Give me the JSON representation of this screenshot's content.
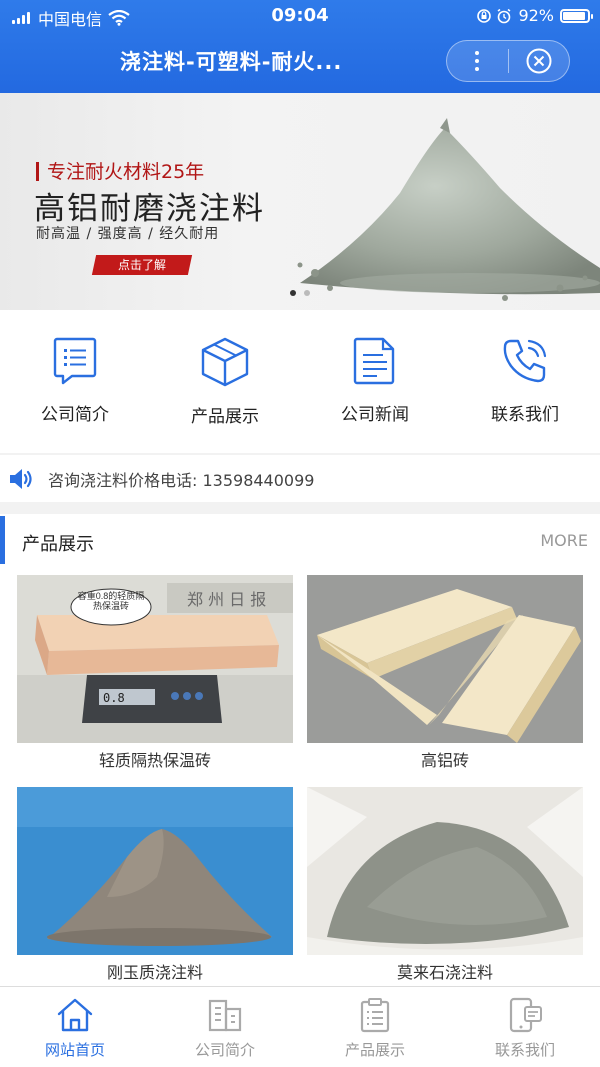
{
  "status_bar": {
    "carrier": "中国电信",
    "time": "09:04",
    "battery": "92%"
  },
  "header": {
    "title": "浇注料-可塑料-耐火..."
  },
  "banner": {
    "tagline": "专注耐火材料25年",
    "headline": "高铝耐磨浇注料",
    "features": "耐高温 / 强度高 / 经久耐用",
    "cta": "点击了解"
  },
  "menu": [
    {
      "label": "公司简介",
      "icon": "chat-doc-icon"
    },
    {
      "label": "产品展示",
      "icon": "cube-icon"
    },
    {
      "label": "公司新闻",
      "icon": "document-icon"
    },
    {
      "label": "联系我们",
      "icon": "phone-icon"
    }
  ],
  "notice": {
    "text": "咨询浇注料价格电话: 13598440099"
  },
  "products": {
    "title": "产品展示",
    "more": "MORE",
    "items": [
      {
        "name": "轻质隔热保温砖",
        "bubble": "容重0.8的轻质隔热保温砖",
        "scale_display": "0.8"
      },
      {
        "name": "高铝砖"
      },
      {
        "name": "刚玉质浇注料"
      },
      {
        "name": "莫来石浇注料"
      }
    ]
  },
  "tabbar": [
    {
      "label": "网站首页",
      "active": true
    },
    {
      "label": "公司简介",
      "active": false
    },
    {
      "label": "产品展示",
      "active": false
    },
    {
      "label": "联系我们",
      "active": false
    }
  ],
  "colors": {
    "accent": "#2a6fe0",
    "header": "#2a72e6",
    "cta": "#c21a1a"
  }
}
